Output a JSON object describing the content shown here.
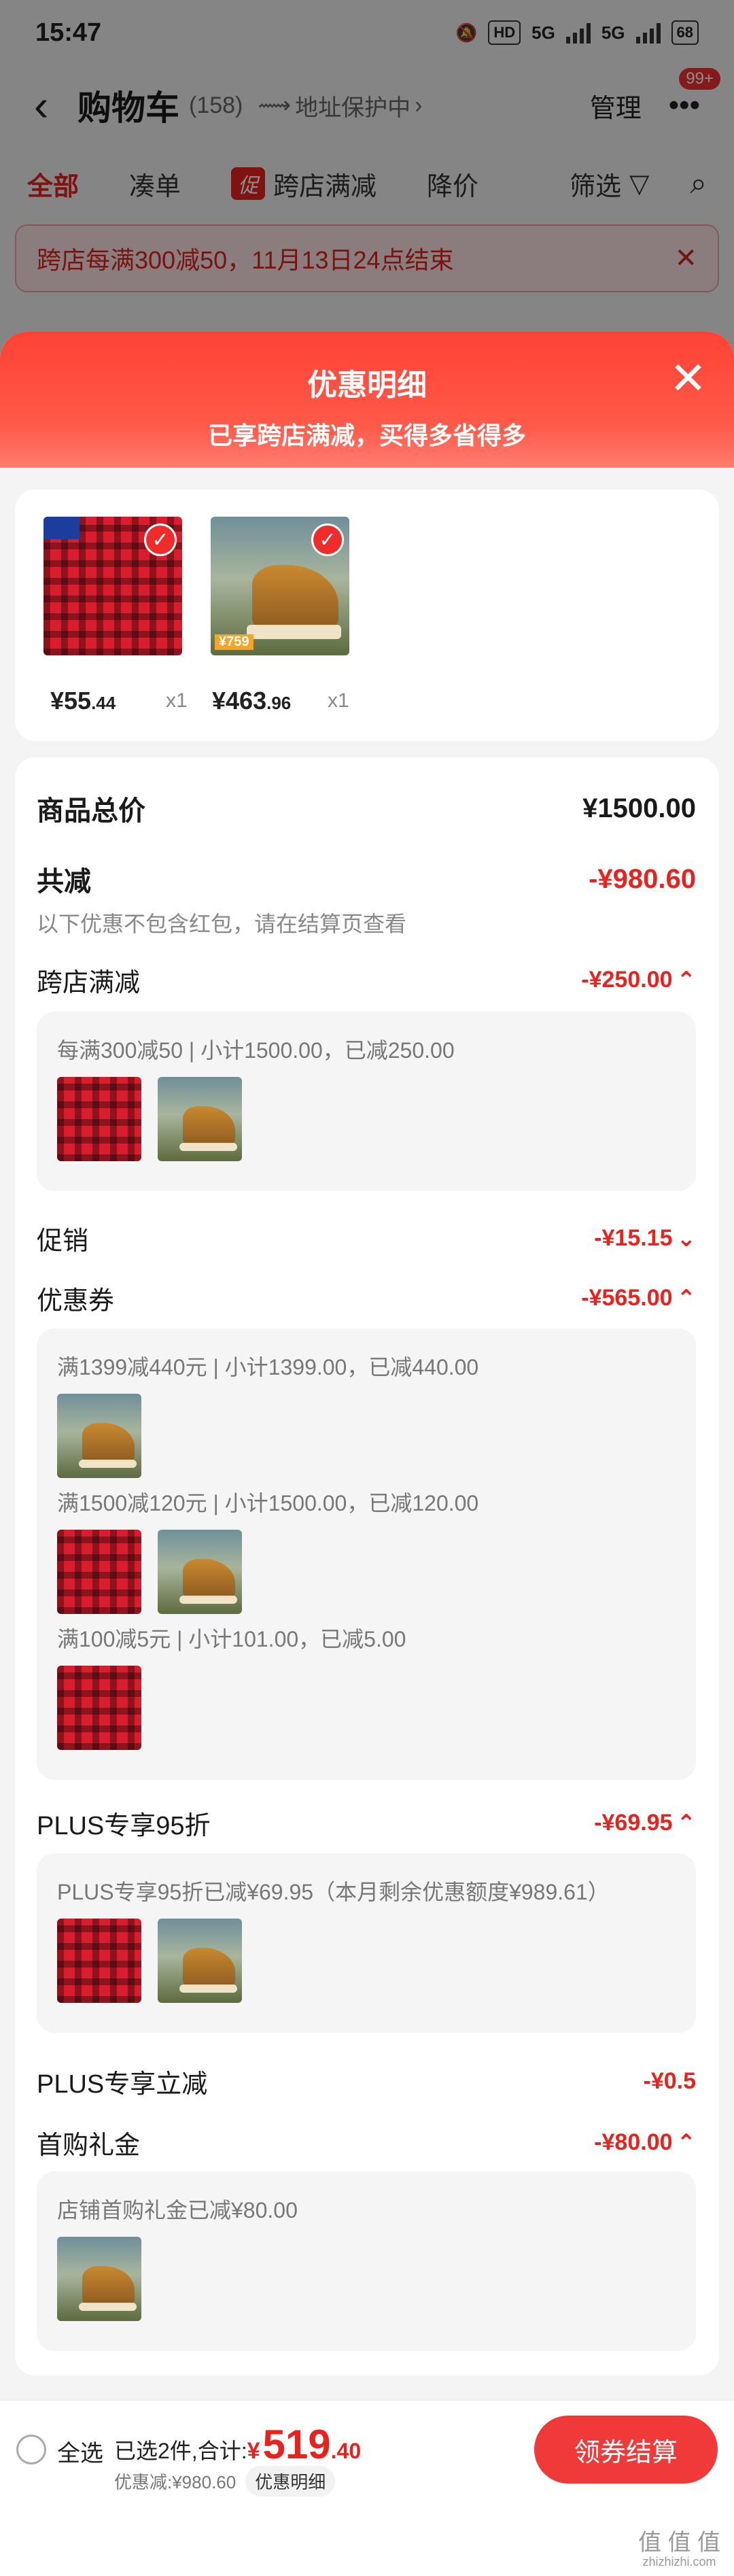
{
  "status_bar": {
    "time": "15:47",
    "hd": "HD",
    "net1": "5G",
    "net2": "5G",
    "battery": "68"
  },
  "header": {
    "title": "购物车",
    "count": "(158)",
    "address": "地址保护中",
    "manage": "管理",
    "badge": "99+"
  },
  "tabs": {
    "all": "全部",
    "coudan": "凑单",
    "promo_tag": "促",
    "promo": "跨店满减",
    "price_drop": "降价",
    "filter": "筛选"
  },
  "notice": {
    "text": "跨店每满300减50，11月13日24点结束"
  },
  "sheet": {
    "title": "优惠明细",
    "subtitle": "已享跨店满减，买得多省得多"
  },
  "products": [
    {
      "price_int": "¥55",
      "price_dec": ".44",
      "qty": "x1",
      "image": "red-plaid-shirt"
    },
    {
      "price_int": "¥463",
      "price_dec": ".96",
      "qty": "x1",
      "image": "timberland-boot",
      "tag": "¥759"
    }
  ],
  "summary": {
    "total_label": "商品总价",
    "total_value": "¥1500.00",
    "saved_label": "共减",
    "saved_value": "-¥980.60",
    "note": "以下优惠不包含红包，请在结算页查看"
  },
  "discounts": {
    "cross_store": {
      "label": "跨店满减",
      "value": "-¥250.00",
      "detail": "每满300减50 | 小计1500.00，已减250.00"
    },
    "promo": {
      "label": "促销",
      "value": "-¥15.15"
    },
    "coupon": {
      "label": "优惠券",
      "value": "-¥565.00",
      "items": [
        "满1399减440元 | 小计1399.00，已减440.00",
        "满1500减120元 | 小计1500.00，已减120.00",
        "满100减5元 | 小计101.00，已减5.00"
      ]
    },
    "plus95": {
      "label": "PLUS专享95折",
      "value": "-¥69.95",
      "detail": "PLUS专享95折已减¥69.95（本月剩余优惠额度¥989.61）"
    },
    "plus_cut": {
      "label": "PLUS专享立减",
      "value": "-¥0.5"
    },
    "first_gift": {
      "label": "首购礼金",
      "value": "-¥80.00",
      "detail": "店铺首购礼金已减¥80.00"
    }
  },
  "bottom": {
    "select_all": "全选",
    "selected": "已选2件,",
    "sum_label": "合计:",
    "currency": "¥",
    "total_int": "519",
    "total_dec": ".40",
    "discount": "优惠减:¥980.60",
    "detail_btn": "优惠明细",
    "pay": "领券结算"
  },
  "watermark": {
    "text": "值 值 值",
    "url": "zhizhizhi.com"
  },
  "colors": {
    "accent": "#e8231f",
    "sheet_header": "#ff4236"
  }
}
